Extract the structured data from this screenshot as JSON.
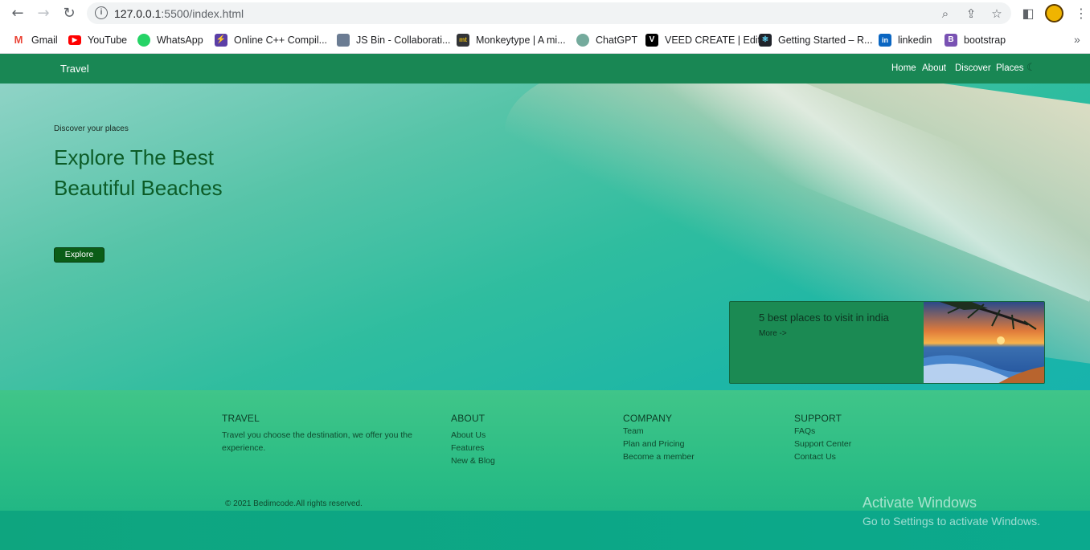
{
  "browser": {
    "url_host": "127.0.0.1",
    "url_rest": ":5500/index.html",
    "icons": [
      "back-icon",
      "forward-icon",
      "reload-icon",
      "info-icon",
      "zoom-icon",
      "share-icon",
      "star-icon",
      "sidebar-icon",
      "menu-icon"
    ],
    "bookmarks": [
      {
        "label": "Gmail",
        "color": "#ea4335"
      },
      {
        "label": "YouTube",
        "color": "#ff0000"
      },
      {
        "label": "WhatsApp",
        "color": "#25d366"
      },
      {
        "label": "Online C++ Compil...",
        "color": "#5b3ea6"
      },
      {
        "label": "JS Bin - Collaborati...",
        "color": "#6b7c93"
      },
      {
        "label": "Monkeytype | A mi...",
        "color": "#323437"
      },
      {
        "label": "ChatGPT",
        "color": "#74aa9c"
      },
      {
        "label": "VEED CREATE | Edit",
        "color": "#000000"
      },
      {
        "label": "Getting Started – R...",
        "color": "#20232a"
      },
      {
        "label": "linkedin",
        "color": "#0a66c2"
      },
      {
        "label": "bootstrap",
        "color": "#7952b3"
      }
    ]
  },
  "navbar": {
    "brand": "Travel",
    "links": [
      "Home",
      "About",
      "Discover",
      "Places"
    ]
  },
  "hero": {
    "subtitle": "Discover your places",
    "title": "Explore The Best Beautiful Beaches",
    "button": "Explore"
  },
  "card": {
    "title": "5 best places to visit in india",
    "more": "More ->"
  },
  "footer": {
    "travel": {
      "heading": "TRAVEL",
      "text": "Travel you choose the destination, we offer you the experience."
    },
    "about": {
      "heading": "ABOUT",
      "links": [
        "About Us",
        "Features",
        "New & Blog"
      ]
    },
    "company": {
      "heading": "COMPANY",
      "links": [
        "Team",
        "Plan and Pricing",
        "Become a member"
      ]
    },
    "support": {
      "heading": "SUPPORT",
      "links": [
        "FAQs",
        "Support Center",
        "Contact Us"
      ]
    },
    "copyright": "© 2021 Bedimcode.All rights reserved."
  },
  "watermark": {
    "line1": "Activate Windows",
    "line2": "Go to Settings to activate Windows."
  }
}
